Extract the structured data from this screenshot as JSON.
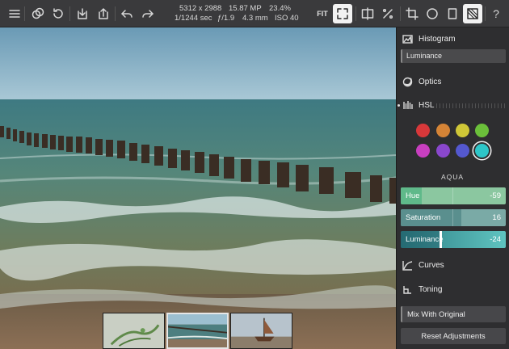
{
  "toolbar": {
    "icons": [
      "menu-icon",
      "layers-icon",
      "history-icon",
      "import-icon",
      "share-icon",
      "undo-icon",
      "redo-icon",
      "fit-label",
      "fullscreen-icon",
      "compare-icon",
      "presets-icon",
      "crop-icon",
      "circle-icon",
      "aspect-icon",
      "mask-icon",
      "help-icon"
    ],
    "fit_label": "FIT",
    "help_label": "?"
  },
  "exif": {
    "dimensions": "5312 x 2988",
    "megapixels": "15.87 MP",
    "zoom": "23.4%",
    "shutter": "1/1244 sec",
    "aperture": "ƒ/1.9",
    "focal": "4.3 mm",
    "iso": "ISO 40"
  },
  "panel": {
    "histogram_label": "Histogram",
    "histogram_mode": "Luminance",
    "optics_label": "Optics",
    "hsl_label": "HSL",
    "curves_label": "Curves",
    "toning_label": "Toning",
    "mix_label": "Mix With Original",
    "reset_label": "Reset Adjustments",
    "selected_color_name": "AQUA",
    "swatches": [
      {
        "name": "red",
        "color": "#d8383a"
      },
      {
        "name": "orange",
        "color": "#d58436"
      },
      {
        "name": "yellow",
        "color": "#cfc737"
      },
      {
        "name": "green",
        "color": "#6bc03a"
      },
      {
        "name": "magenta",
        "color": "#c83fc0"
      },
      {
        "name": "purple",
        "color": "#8a47cc"
      },
      {
        "name": "blue",
        "color": "#5458cf"
      },
      {
        "name": "aqua",
        "color": "#2ec6c8",
        "selected": true
      }
    ],
    "sliders": [
      {
        "label": "Hue",
        "value": "-59",
        "level": 0.2
      },
      {
        "label": "Saturation",
        "value": "16",
        "level": 0.58
      },
      {
        "label": "Luminance",
        "value": "-24",
        "level": 0.38
      }
    ]
  },
  "filmstrip": {
    "thumbnails": [
      "plant-thumbnail",
      "beach-thumbnail",
      "boat-thumbnail"
    ],
    "selected_index": 1
  }
}
